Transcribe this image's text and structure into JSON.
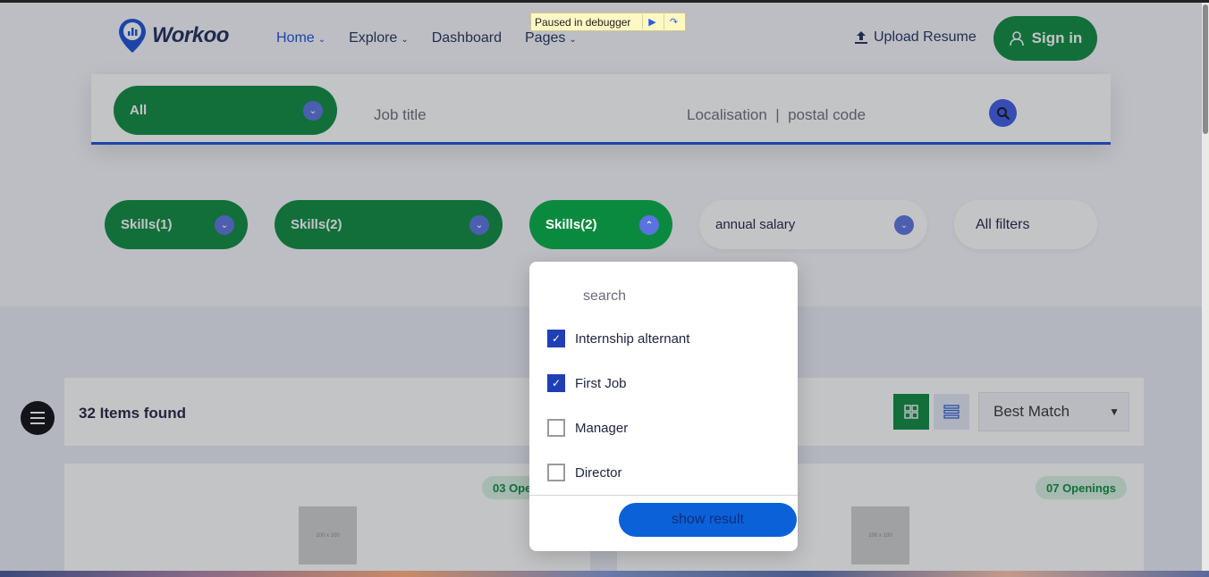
{
  "brand": {
    "name": "Workoo",
    "accent": "#0a8a3e",
    "link": "#1a4fd6"
  },
  "nav": {
    "items": [
      {
        "label": "Home",
        "has_dropdown": true
      },
      {
        "label": "Explore",
        "has_dropdown": true
      },
      {
        "label": "Dashboard",
        "has_dropdown": false
      },
      {
        "label": "Pages",
        "has_dropdown": true
      }
    ]
  },
  "debugger": {
    "label": "Paused in debugger"
  },
  "header": {
    "upload_label": "Upload Resume",
    "signin_label": "Sign in"
  },
  "search": {
    "category": "All",
    "job_placeholder": "Job title",
    "location_placeholder": "Localisation  |  postal code"
  },
  "filters": [
    {
      "label": "Skills(1)"
    },
    {
      "label": "Skills(2)"
    },
    {
      "label": "Skills(2)",
      "open": true
    },
    {
      "label": "annual salary"
    },
    {
      "label": "All filters"
    }
  ],
  "dropdown": {
    "search_placeholder": "search",
    "options": [
      {
        "label": "Internship alternant",
        "checked": true
      },
      {
        "label": "First Job",
        "checked": true
      },
      {
        "label": "Manager",
        "checked": false
      },
      {
        "label": "Director",
        "checked": false
      }
    ],
    "button_label": "show result"
  },
  "results": {
    "count_label": "32 Items found",
    "sort_value": "Best Match"
  },
  "cards": [
    {
      "openings": "03 Openings",
      "thumb_label": "100 x 100"
    },
    {
      "openings": "07 Openings",
      "thumb_label": "100 x 100"
    }
  ]
}
